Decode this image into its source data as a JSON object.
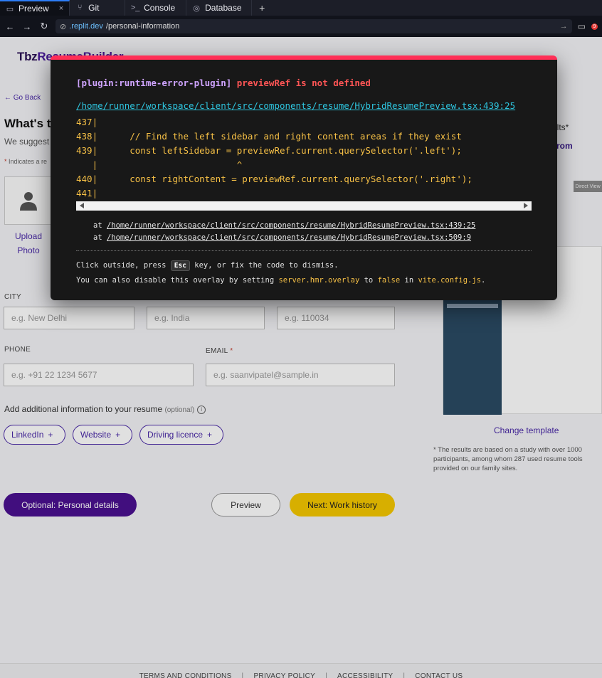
{
  "tabs": [
    {
      "label": "Preview",
      "icon": "monitor-icon",
      "active": true,
      "close": "×"
    },
    {
      "label": "Git",
      "icon": "git-branch-icon"
    },
    {
      "label": "Console",
      "icon": "terminal-icon"
    },
    {
      "label": "Database",
      "icon": "database-icon"
    }
  ],
  "tab_add": "+",
  "url": {
    "domain": ".replit.dev",
    "path": "/personal-information"
  },
  "notification_count": "9",
  "page": {
    "logo_pre": "Tbz",
    "logo_main": "ResumeBuilder",
    "back": "Go Back",
    "heading": "What's t",
    "suggest": "We suggest",
    "indicates": "Indicates a re",
    "upload_1": "Upload",
    "upload_2": "Photo",
    "city_label": "CITY",
    "city_placeholder": "e.g. New Delhi",
    "country_placeholder": "e.g. India",
    "pin_placeholder": "e.g. 110034",
    "phone_label": "PHONE",
    "phone_placeholder": "e.g. +91 22 1234 5677",
    "email_label": "EMAIL",
    "email_placeholder": "e.g. saanvipatel@sample.in",
    "additional": "Add additional information to your resume",
    "optional": "(optional)",
    "pills": [
      "LinkedIn",
      "Website",
      "Driving licence"
    ],
    "btn_optional": "Optional: Personal details",
    "btn_preview": "Preview",
    "btn_next": "Next: Work history",
    "rc_results": "sults*",
    "rc_from": "rom",
    "rc_input": "Direct View",
    "change_template": "Change template",
    "footnote": "* The results are based on a study with over 1000 participants, among whom 287 used resume tools provided on our family sites.",
    "footer": [
      "TERMS AND CONDITIONS",
      "PRIVACY POLICY",
      "ACCESSIBILITY",
      "CONTACT US"
    ]
  },
  "overlay": {
    "plugin": "[plugin:runtime-error-plugin]",
    "error": "previewRef is not defined",
    "file": "/home/runner/workspace/client/src/components/resume/HybridResumePreview.tsx:439:25",
    "code_lines": [
      "437|",
      "438|      // Find the left sidebar and right content areas if they exist",
      "439|      const leftSidebar = previewRef.current.querySelector('.left');",
      "   |                          ^",
      "440|      const rightContent = previewRef.current.querySelector('.right');",
      "441|"
    ],
    "stack_1_at": "at ",
    "stack_1": "/home/runner/workspace/client/src/components/resume/HybridResumePreview.tsx:439:25",
    "stack_2_at": "at ",
    "stack_2": "/home/runner/workspace/client/src/components/resume/HybridResumePreview.tsx:509:9",
    "tip_a": "Click outside, press ",
    "tip_key": "Esc",
    "tip_b": " key, or fix the code to dismiss.",
    "tip_c": "You can also disable this overlay by setting ",
    "tip_setting": "server.hmr.overlay",
    "tip_d": " to ",
    "tip_false": "false",
    "tip_e": " in ",
    "tip_file": "vite.config.js",
    "tip_f": "."
  }
}
